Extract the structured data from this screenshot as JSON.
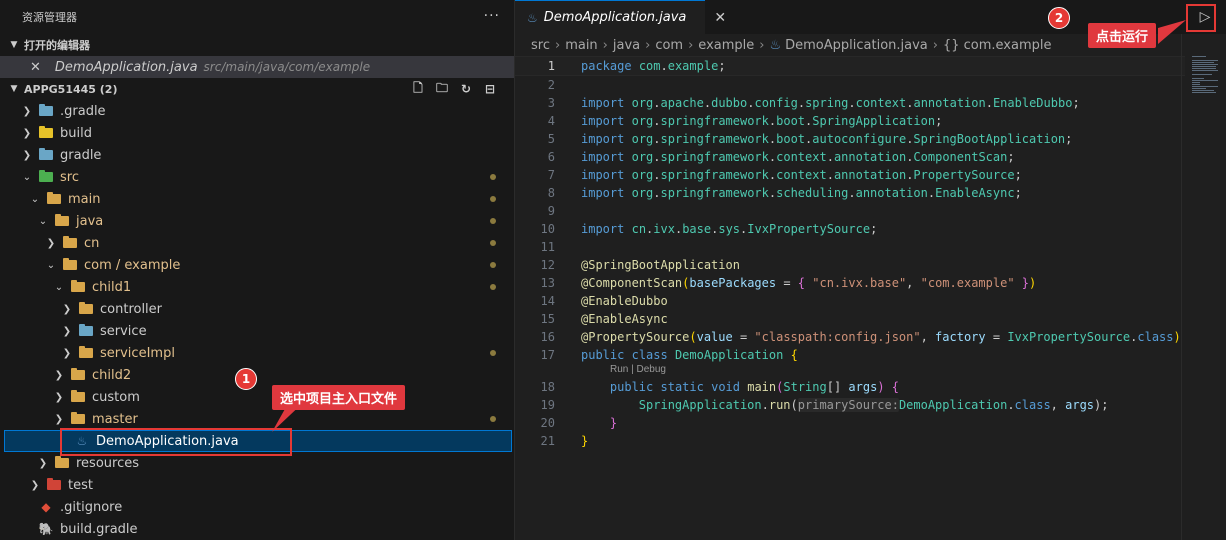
{
  "sidebar": {
    "title": "资源管理器",
    "more": "···",
    "open_editors": {
      "label": "打开的编辑器",
      "file_name": "DemoApplication.java",
      "file_path": "src/main/java/com/example"
    },
    "project": {
      "label": "APPG51445 (2)"
    },
    "tree": [
      {
        "label": ".gradle"
      },
      {
        "label": "build"
      },
      {
        "label": "gradle"
      },
      {
        "label": "src"
      },
      {
        "label": "main"
      },
      {
        "label": "java"
      },
      {
        "label": "cn"
      },
      {
        "label": "com / example"
      },
      {
        "label": "child1"
      },
      {
        "label": "controller"
      },
      {
        "label": "service"
      },
      {
        "label": "serviceImpl"
      },
      {
        "label": "child2"
      },
      {
        "label": "custom"
      },
      {
        "label": "master"
      },
      {
        "label": "DemoApplication.java"
      },
      {
        "label": "resources"
      },
      {
        "label": "test"
      },
      {
        "label": ".gitignore"
      },
      {
        "label": "build.gradle"
      }
    ]
  },
  "editor": {
    "tab": "DemoApplication.java",
    "breadcrumb": [
      "src",
      "main",
      "java",
      "com",
      "example",
      "DemoApplication.java",
      "{} com.example"
    ],
    "codelens": "Run | Debug",
    "line_numbers": [
      "1",
      "2",
      "3",
      "4",
      "5",
      "6",
      "7",
      "8",
      "9",
      "10",
      "11",
      "12",
      "13",
      "14",
      "15",
      "16",
      "17",
      "18",
      "19",
      "20",
      "21"
    ]
  },
  "annotations": {
    "badge1": "1",
    "callout1": "选中项目主入口文件",
    "badge2": "2",
    "callout2": "点击运行"
  },
  "colors": {
    "accent": "#0078d4",
    "annotation_red": "#e53935"
  }
}
